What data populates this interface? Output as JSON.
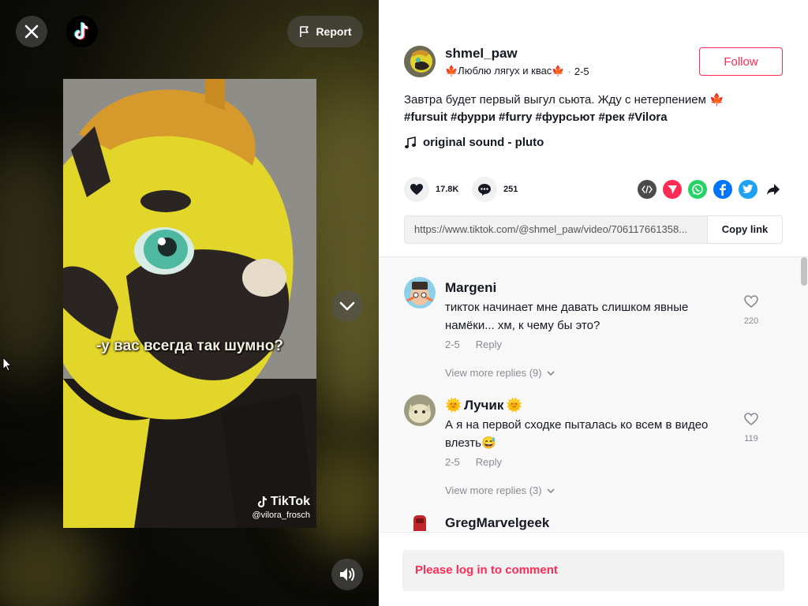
{
  "video": {
    "report_label": "Report",
    "caption": "-у вас всегда так шумно?",
    "watermark_brand": "TikTok",
    "watermark_user": "@vilora_frosch"
  },
  "author": {
    "username": "shmel_paw",
    "nickname": "🍁Люблю лягух и квас🍁",
    "separator": "·",
    "date": "2-5",
    "follow_label": "Follow"
  },
  "post": {
    "description": "Завтра будет первый выгул сьюта. Жду с нетерпением 🍁",
    "hashtags": [
      "#fursuit",
      "#фурри",
      "#furry",
      "#фурсьют",
      "#рек",
      "#Vilora"
    ],
    "sound": "original sound - pluto"
  },
  "stats": {
    "likes": "17.8K",
    "comments": "251"
  },
  "share": {
    "icons": [
      "embed-icon",
      "send-icon",
      "whatsapp-icon",
      "facebook-icon",
      "twitter-icon",
      "share-arrow-icon"
    ],
    "colors": {
      "embed": "#4b4b4b",
      "send": "#fe2c55",
      "whatsapp": "#25d366",
      "facebook": "#0075fa",
      "twitter": "#1da1f2"
    }
  },
  "link": {
    "url": "https://www.tiktok.com/@shmel_paw/video/706117661358...",
    "copy_label": "Copy link"
  },
  "comments": [
    {
      "username": "Margeni",
      "text": "тикток начинает мне давать слишком явные намёки... хм, к чему бы это?",
      "date": "2-5",
      "reply_label": "Reply",
      "likes": "220",
      "more_replies": "View more replies (9)"
    },
    {
      "username": "Лучик",
      "name_decoration": "🌞",
      "text": "А я на первой сходке пыталась ко всем в видео влезть😅",
      "date": "2-5",
      "reply_label": "Reply",
      "likes": "119",
      "more_replies": "View more replies (3)"
    },
    {
      "username": "GregMarvelgeek"
    }
  ],
  "comment_bar": {
    "login_prompt": "Please log in to comment"
  },
  "colors": {
    "accent": "#fe2c55",
    "text": "#161823",
    "muted": "#8a8b91"
  }
}
